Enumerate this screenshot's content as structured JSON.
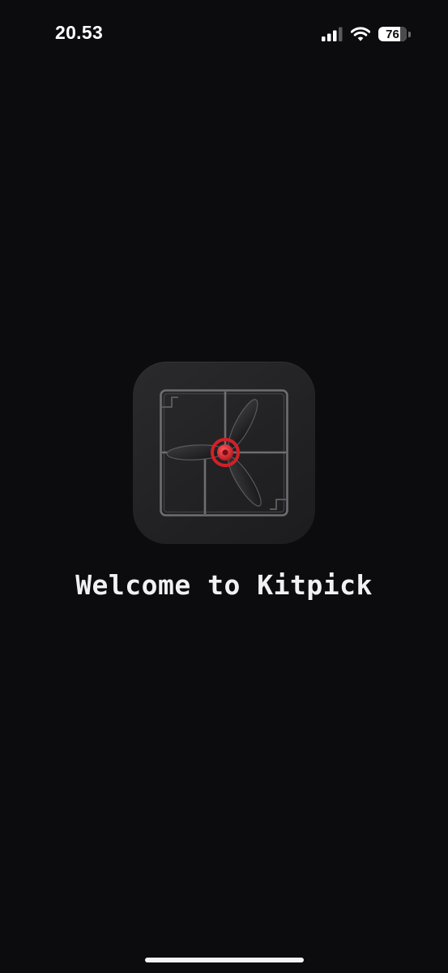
{
  "status_bar": {
    "time": "20.53",
    "signal_icon": "cellular-signal-icon",
    "wifi_icon": "wifi-icon",
    "battery_level": "76",
    "battery_fraction": 0.76
  },
  "app_icon": {
    "icon": "kitpick-propeller-sprue-logo",
    "accent_color": "#e3242b"
  },
  "welcome": {
    "title": "Welcome to Kitpick"
  },
  "colors": {
    "background": "#0c0c0e",
    "icon_tile": "#252527",
    "text": "#f1f1f1"
  }
}
